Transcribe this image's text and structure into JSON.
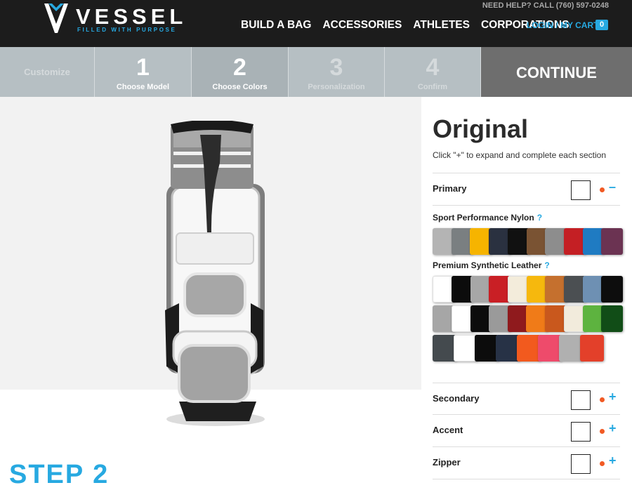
{
  "header": {
    "logo_word": "VESSEL",
    "logo_tag": "FILLED WITH PURPOSE",
    "help_text": "NEED HELP? CALL (760) 597-0248",
    "nav": [
      "BUILD A BAG",
      "ACCESSORIES",
      "ATHLETES",
      "CORPORATIONS"
    ],
    "login_cart": "LOGIN / MY CART",
    "cart_count": "0"
  },
  "steps": {
    "customize_label": "Customize",
    "items": [
      {
        "num": "1",
        "label": "Choose Model"
      },
      {
        "num": "2",
        "label": "Choose Colors"
      },
      {
        "num": "3",
        "label": "Personalization"
      },
      {
        "num": "4",
        "label": "Confirm"
      }
    ],
    "continue_label": "CONTINUE"
  },
  "stage": {
    "step_badge": "STEP 2"
  },
  "panel": {
    "model_title": "Original",
    "instructions": "Click \"+\" to expand and complete each section",
    "sections": [
      {
        "label": "Primary",
        "toggle": "–"
      },
      {
        "label": "Secondary",
        "toggle": "+"
      },
      {
        "label": "Accent",
        "toggle": "+"
      },
      {
        "label": "Zipper",
        "toggle": "+"
      }
    ],
    "nylon_title": "Sport Performance Nylon",
    "leather_title": "Premium Synthetic Leather",
    "help_mark": "?",
    "nylon_colors": [
      "#b4b4b4",
      "#7a7f81",
      "#f6b400",
      "#2a3140",
      "#111111",
      "#7a5333",
      "#8d8d8d",
      "#c41f24",
      "#1f7bc2",
      "#6b3352"
    ],
    "leather_colors_row1": [
      "#ffffff",
      "#0c0c0c",
      "#a7a7a7",
      "#c91f25",
      "#f3ecdb",
      "#f6b80d",
      "#c5702e",
      "#4b4f52",
      "#6e90b3",
      "#0d0d0d"
    ],
    "leather_colors_row2": [
      "#a6a6a6",
      "#ffffff",
      "#0c0c0c",
      "#9a9a9a",
      "#8f1a1d",
      "#f07b18",
      "#c9581d",
      "#f2ebdc",
      "#5db33f",
      "#114d17"
    ],
    "leather_colors_row3": [
      "#444a4e",
      "#ffffff",
      "#0c0c0c",
      "#273246",
      "#f25a1e",
      "#ee4b6b",
      "#b0b0b0",
      "#e3402a"
    ]
  },
  "colors": {
    "accent": "#27a9e1",
    "indicator": "#f15a24",
    "header_bg": "#1c1c1c",
    "continue_bg": "#6e6e6e"
  }
}
